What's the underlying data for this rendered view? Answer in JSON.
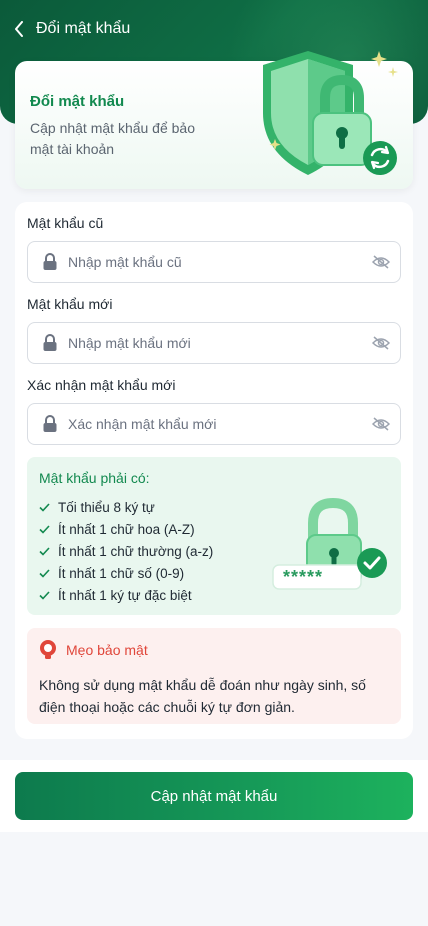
{
  "header": {
    "title": "Đổi mật khẩu",
    "icons": {
      "back": "chevron-left-icon"
    }
  },
  "hero": {
    "title": "Đổi mật khẩu",
    "description": "Cập nhật mật khẩu để bảo mật tài khoản"
  },
  "form": {
    "old": {
      "label": "Mật khẩu cũ",
      "placeholder": "Nhập mật khẩu cũ",
      "value": ""
    },
    "new": {
      "label": "Mật khẩu mới",
      "placeholder": "Nhập mật khẩu mới",
      "value": ""
    },
    "confirm": {
      "label": "Xác nhận mật khẩu mới",
      "placeholder": "Xác nhận mật khẩu mới",
      "value": ""
    }
  },
  "rules": {
    "title": "Mật khẩu phải có:",
    "items": [
      "Tối thiểu 8 ký tự",
      "Ít nhất 1 chữ hoa (A-Z)",
      "Ít nhất 1 chữ thường (a-z)",
      "Ít nhất 1 chữ số (0-9)",
      "Ít nhất 1 ký tự đặc biệt"
    ],
    "art_text": "*****"
  },
  "tip": {
    "title": "Mẹo bảo mật",
    "text": "Không sử dụng mật khẩu dễ đoán như ngày sinh, số điện thoại hoặc các chuỗi ký tự đơn giản."
  },
  "submit_label": "Cập nhật mật khẩu",
  "colors": {
    "primary": "#12894f",
    "header": "#0b5a3a",
    "danger": "#e0463a",
    "rules_bg": "#e9f7ef",
    "tip_bg": "#fdf0ef"
  }
}
